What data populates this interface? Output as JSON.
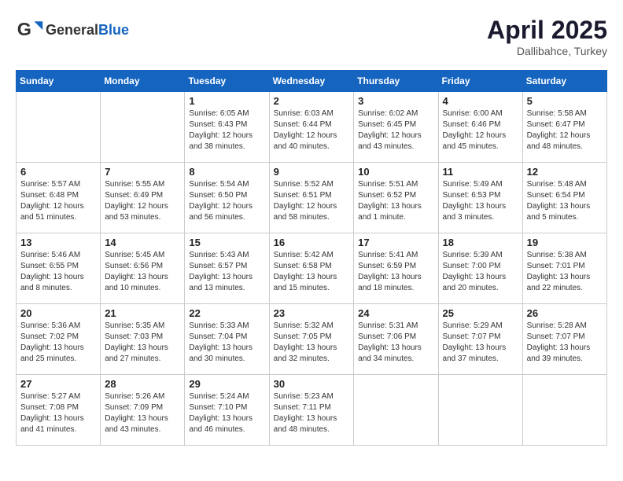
{
  "header": {
    "logo_general": "General",
    "logo_blue": "Blue",
    "title": "April 2025",
    "subtitle": "Dallibahce, Turkey"
  },
  "calendar": {
    "days_of_week": [
      "Sunday",
      "Monday",
      "Tuesday",
      "Wednesday",
      "Thursday",
      "Friday",
      "Saturday"
    ],
    "weeks": [
      [
        {
          "day": "",
          "info": ""
        },
        {
          "day": "",
          "info": ""
        },
        {
          "day": "1",
          "info": "Sunrise: 6:05 AM\nSunset: 6:43 PM\nDaylight: 12 hours and 38 minutes."
        },
        {
          "day": "2",
          "info": "Sunrise: 6:03 AM\nSunset: 6:44 PM\nDaylight: 12 hours and 40 minutes."
        },
        {
          "day": "3",
          "info": "Sunrise: 6:02 AM\nSunset: 6:45 PM\nDaylight: 12 hours and 43 minutes."
        },
        {
          "day": "4",
          "info": "Sunrise: 6:00 AM\nSunset: 6:46 PM\nDaylight: 12 hours and 45 minutes."
        },
        {
          "day": "5",
          "info": "Sunrise: 5:58 AM\nSunset: 6:47 PM\nDaylight: 12 hours and 48 minutes."
        }
      ],
      [
        {
          "day": "6",
          "info": "Sunrise: 5:57 AM\nSunset: 6:48 PM\nDaylight: 12 hours and 51 minutes."
        },
        {
          "day": "7",
          "info": "Sunrise: 5:55 AM\nSunset: 6:49 PM\nDaylight: 12 hours and 53 minutes."
        },
        {
          "day": "8",
          "info": "Sunrise: 5:54 AM\nSunset: 6:50 PM\nDaylight: 12 hours and 56 minutes."
        },
        {
          "day": "9",
          "info": "Sunrise: 5:52 AM\nSunset: 6:51 PM\nDaylight: 12 hours and 58 minutes."
        },
        {
          "day": "10",
          "info": "Sunrise: 5:51 AM\nSunset: 6:52 PM\nDaylight: 13 hours and 1 minute."
        },
        {
          "day": "11",
          "info": "Sunrise: 5:49 AM\nSunset: 6:53 PM\nDaylight: 13 hours and 3 minutes."
        },
        {
          "day": "12",
          "info": "Sunrise: 5:48 AM\nSunset: 6:54 PM\nDaylight: 13 hours and 5 minutes."
        }
      ],
      [
        {
          "day": "13",
          "info": "Sunrise: 5:46 AM\nSunset: 6:55 PM\nDaylight: 13 hours and 8 minutes."
        },
        {
          "day": "14",
          "info": "Sunrise: 5:45 AM\nSunset: 6:56 PM\nDaylight: 13 hours and 10 minutes."
        },
        {
          "day": "15",
          "info": "Sunrise: 5:43 AM\nSunset: 6:57 PM\nDaylight: 13 hours and 13 minutes."
        },
        {
          "day": "16",
          "info": "Sunrise: 5:42 AM\nSunset: 6:58 PM\nDaylight: 13 hours and 15 minutes."
        },
        {
          "day": "17",
          "info": "Sunrise: 5:41 AM\nSunset: 6:59 PM\nDaylight: 13 hours and 18 minutes."
        },
        {
          "day": "18",
          "info": "Sunrise: 5:39 AM\nSunset: 7:00 PM\nDaylight: 13 hours and 20 minutes."
        },
        {
          "day": "19",
          "info": "Sunrise: 5:38 AM\nSunset: 7:01 PM\nDaylight: 13 hours and 22 minutes."
        }
      ],
      [
        {
          "day": "20",
          "info": "Sunrise: 5:36 AM\nSunset: 7:02 PM\nDaylight: 13 hours and 25 minutes."
        },
        {
          "day": "21",
          "info": "Sunrise: 5:35 AM\nSunset: 7:03 PM\nDaylight: 13 hours and 27 minutes."
        },
        {
          "day": "22",
          "info": "Sunrise: 5:33 AM\nSunset: 7:04 PM\nDaylight: 13 hours and 30 minutes."
        },
        {
          "day": "23",
          "info": "Sunrise: 5:32 AM\nSunset: 7:05 PM\nDaylight: 13 hours and 32 minutes."
        },
        {
          "day": "24",
          "info": "Sunrise: 5:31 AM\nSunset: 7:06 PM\nDaylight: 13 hours and 34 minutes."
        },
        {
          "day": "25",
          "info": "Sunrise: 5:29 AM\nSunset: 7:07 PM\nDaylight: 13 hours and 37 minutes."
        },
        {
          "day": "26",
          "info": "Sunrise: 5:28 AM\nSunset: 7:07 PM\nDaylight: 13 hours and 39 minutes."
        }
      ],
      [
        {
          "day": "27",
          "info": "Sunrise: 5:27 AM\nSunset: 7:08 PM\nDaylight: 13 hours and 41 minutes."
        },
        {
          "day": "28",
          "info": "Sunrise: 5:26 AM\nSunset: 7:09 PM\nDaylight: 13 hours and 43 minutes."
        },
        {
          "day": "29",
          "info": "Sunrise: 5:24 AM\nSunset: 7:10 PM\nDaylight: 13 hours and 46 minutes."
        },
        {
          "day": "30",
          "info": "Sunrise: 5:23 AM\nSunset: 7:11 PM\nDaylight: 13 hours and 48 minutes."
        },
        {
          "day": "",
          "info": ""
        },
        {
          "day": "",
          "info": ""
        },
        {
          "day": "",
          "info": ""
        }
      ]
    ]
  }
}
